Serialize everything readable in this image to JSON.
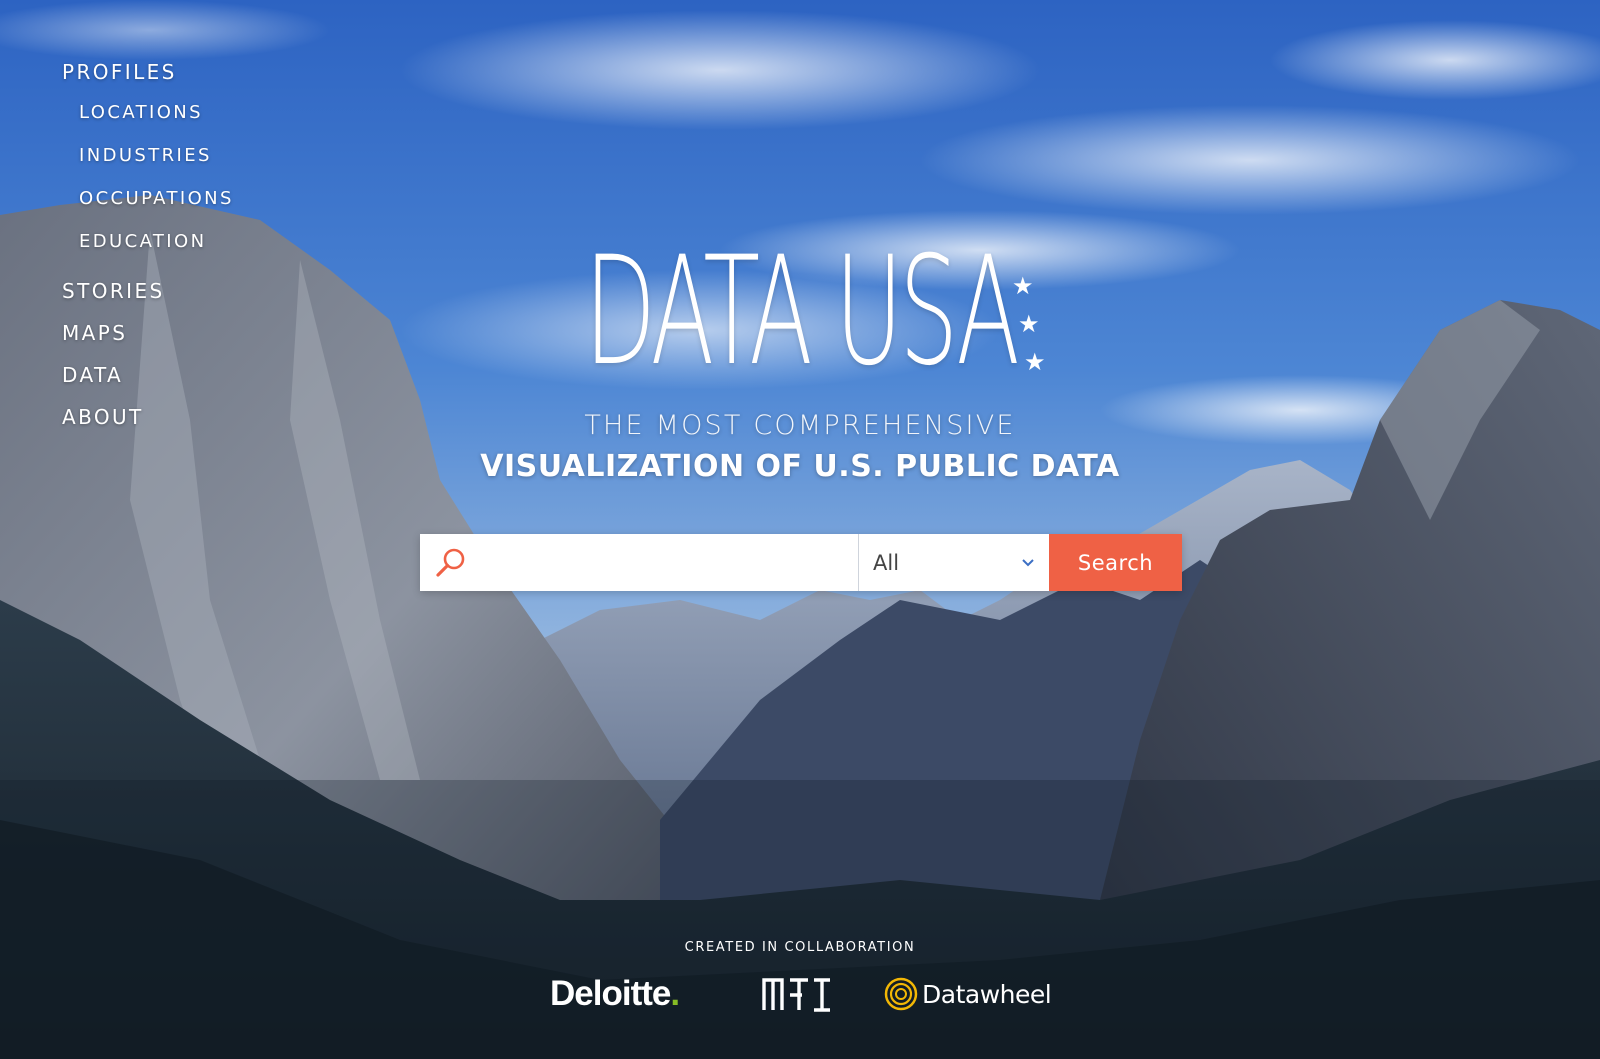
{
  "nav": {
    "profiles": "PROFILES",
    "sub_items": [
      "LOCATIONS",
      "INDUSTRIES",
      "OCCUPATIONS",
      "EDUCATION"
    ],
    "stories": "STORIES",
    "maps": "MAPS",
    "data": "DATA",
    "about": "ABOUT"
  },
  "logo": {
    "text": "DATA USA",
    "stars": [
      "★",
      "★",
      "★"
    ]
  },
  "tagline": {
    "line1": "THE MOST COMPREHENSIVE",
    "line2": "VISUALIZATION OF U.S. PUBLIC DATA"
  },
  "search": {
    "icon": "search-icon",
    "input_value": "",
    "placeholder": "",
    "select_value": "All",
    "select_icon": "chevron-down-icon",
    "button_label": "Search"
  },
  "footer": {
    "collab_text": "CREATED IN COLLABORATION",
    "partners": {
      "deloitte": "Deloitte",
      "deloitte_dot": ".",
      "mit": "MIT",
      "datawheel": "Datawheel"
    }
  },
  "colors": {
    "accent": "#ef6145",
    "deloitte_green": "#86bc25",
    "datawheel_gold": "#f2b705",
    "sky": "#3f73c8"
  }
}
